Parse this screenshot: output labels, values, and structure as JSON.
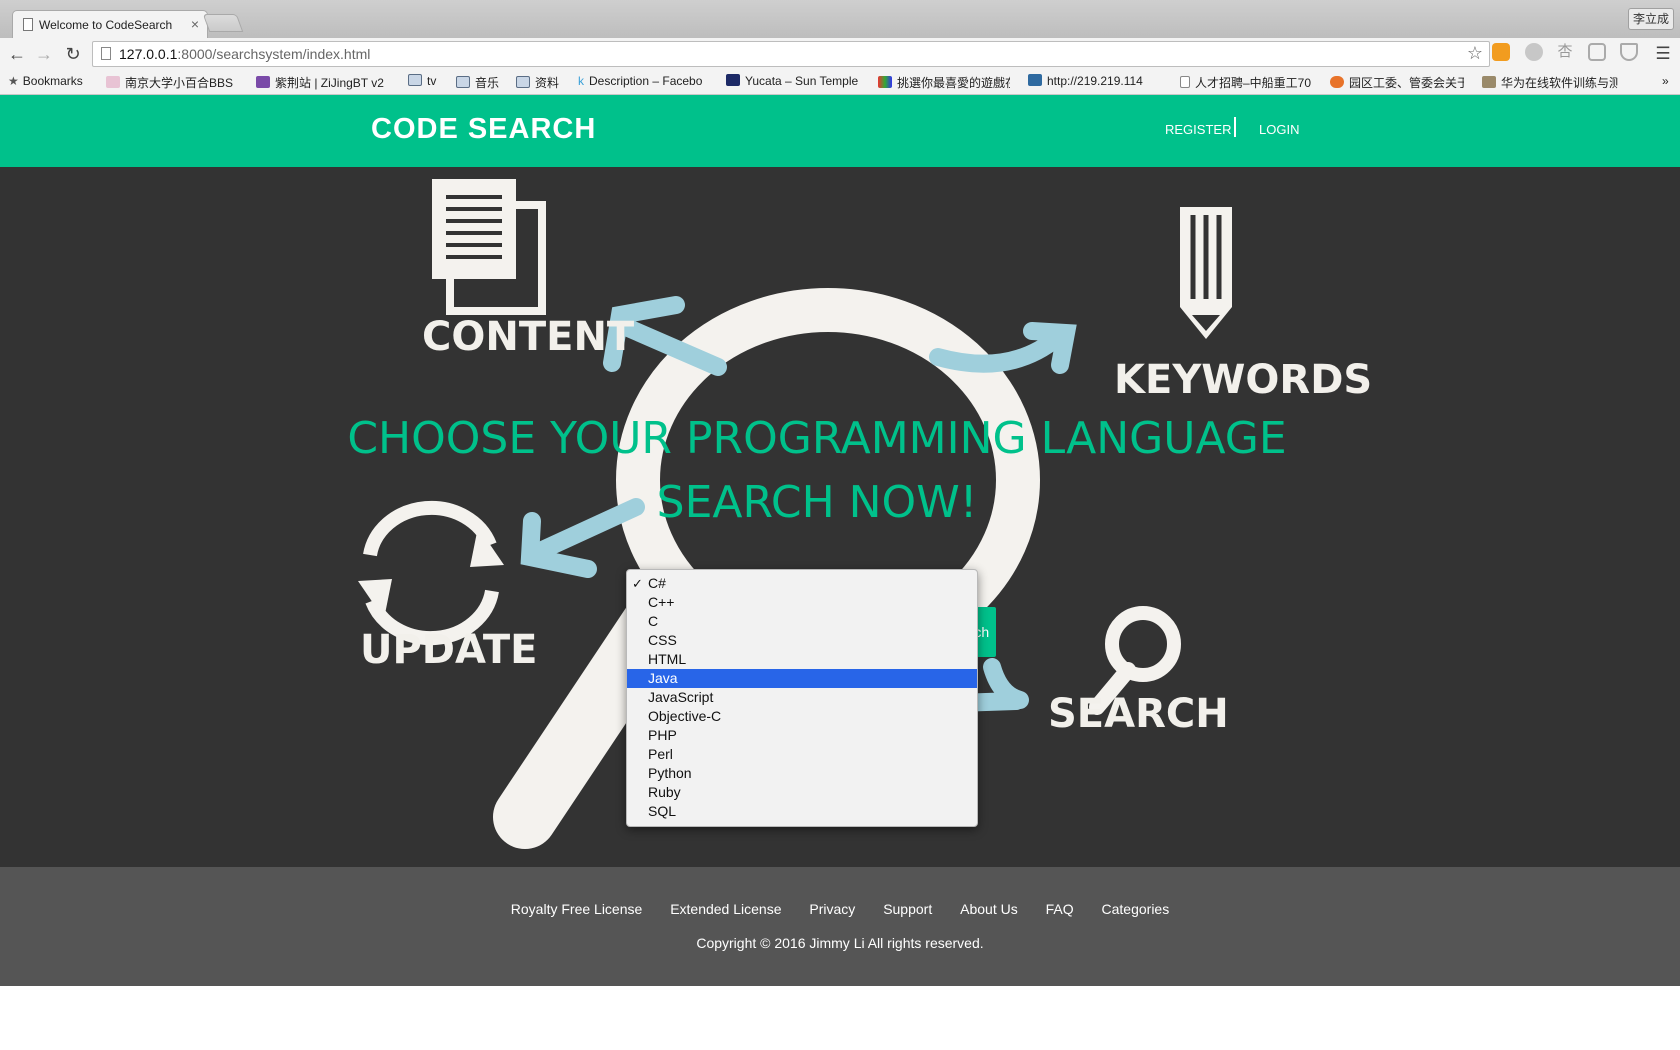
{
  "browser": {
    "tab_title": "Welcome to CodeSearch",
    "tab_close": "×",
    "profile_name": "李立成",
    "url_host": "127.0.0.1",
    "url_rest": ":8000/searchsystem/index.html",
    "bookmarks": [
      {
        "label": "Bookmarks",
        "icon": "star-icon"
      },
      {
        "label": "南京大学小百合BBS - ...",
        "icon": "site-icon"
      },
      {
        "label": "紫荆站 | ZiJingBT v2",
        "icon": "site-icon"
      },
      {
        "label": "tv",
        "icon": "folder-icon"
      },
      {
        "label": "音乐",
        "icon": "folder-icon"
      },
      {
        "label": "资料",
        "icon": "folder-icon"
      },
      {
        "label": "Description – Facebo",
        "icon": "site-icon"
      },
      {
        "label": "Yucata – Sun Temple",
        "icon": "site-icon"
      },
      {
        "label": "挑選你最喜愛的遊戲在",
        "icon": "site-icon"
      },
      {
        "label": "http://219.219.114",
        "icon": "site-icon"
      },
      {
        "label": "人才招聘–中船重工70",
        "icon": "page-icon"
      },
      {
        "label": "园区工委、管委会关于",
        "icon": "site-icon"
      },
      {
        "label": "华为在线软件训练与测",
        "icon": "site-icon"
      }
    ],
    "more_bookmarks": "»"
  },
  "header": {
    "logo": "CODE SEARCH",
    "register": "REGISTER",
    "login": "LOGIN"
  },
  "hero": {
    "art_words": {
      "content": "CONTENT",
      "keywords": "KEYWORDS",
      "update": "UPDATE",
      "search": "SEARCH"
    },
    "headline_line1": "CHOOSE YOUR PROGRAMMING LANGUAGE",
    "headline_line2": "SEARCH NOW!",
    "search_button": "Search",
    "language_select": {
      "selected": "C#",
      "highlighted": "Java",
      "options": [
        "C#",
        "C++",
        "C",
        "CSS",
        "HTML",
        "Java",
        "JavaScript",
        "Objective-C",
        "PHP",
        "Perl",
        "Python",
        "Ruby",
        "SQL"
      ]
    }
  },
  "footer": {
    "links": [
      "Royalty Free License",
      "Extended License",
      "Privacy",
      "Support",
      "About Us",
      "FAQ",
      "Categories"
    ],
    "copyright": "Copyright © 2016 Jimmy Li All rights reserved."
  },
  "colors": {
    "brand_green": "#00c18b",
    "hero_bg": "#333333",
    "footer_bg": "#555555",
    "arrow_blue": "#9fcfdc",
    "selection_blue": "#2865e8"
  }
}
